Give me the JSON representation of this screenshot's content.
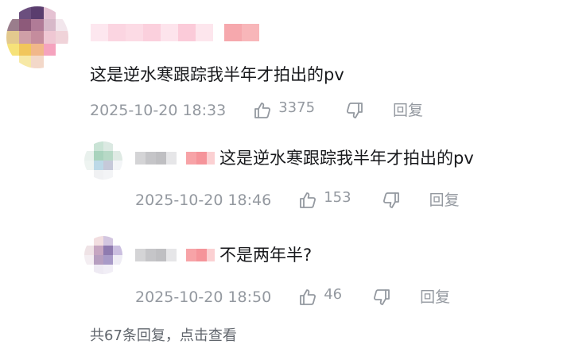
{
  "comment": {
    "text": "这是逆水寒跟踪我半年才拍出的pv",
    "time": "2025-10-20 18:33",
    "likes": "3375",
    "reply_label": "回复"
  },
  "replies": [
    {
      "text": "这是逆水寒跟踪我半年才拍出的pv",
      "time": "2025-10-20 18:46",
      "likes": "153",
      "reply_label": "回复"
    },
    {
      "text": "不是两年半?",
      "time": "2025-10-20 18:50",
      "likes": "46",
      "reply_label": "回复"
    }
  ],
  "more_replies": "共67条回复，点击查看",
  "icons": {
    "like": "thumbs-up-outline-icon",
    "dislike": "thumbs-down-outline-icon"
  },
  "colors": {
    "text": "#18191c",
    "meta": "#9499a0",
    "more": "#61666d"
  }
}
